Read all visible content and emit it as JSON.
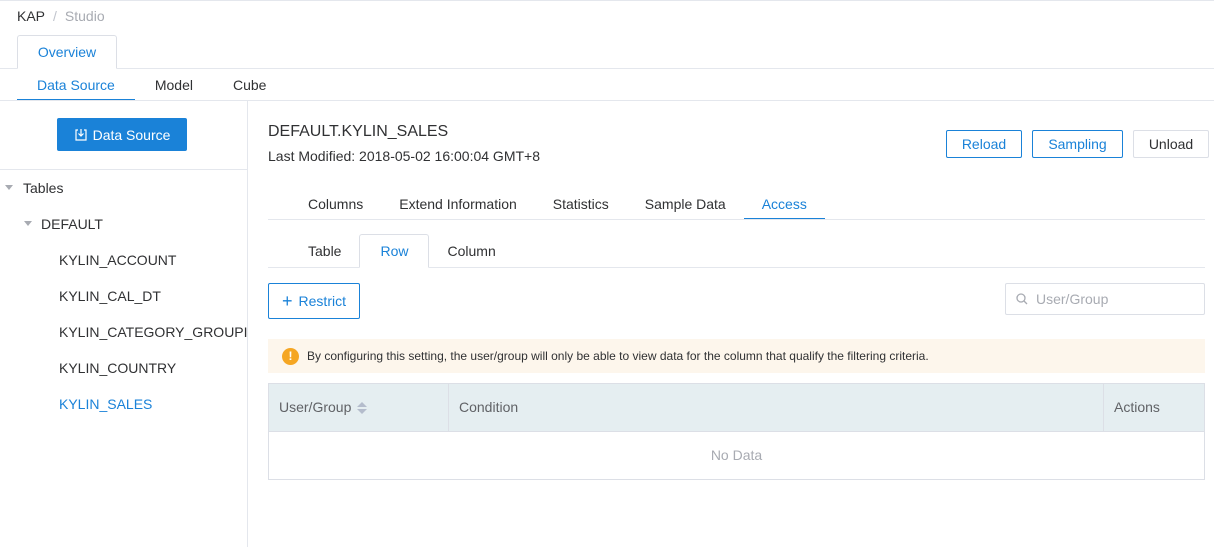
{
  "breadcrumb": {
    "first": "KAP",
    "separator": "/",
    "second": "Studio"
  },
  "card_tab": {
    "label": "Overview"
  },
  "main_nav": {
    "tabs": [
      "Data Source",
      "Model",
      "Cube"
    ],
    "active": "Data Source"
  },
  "sidebar": {
    "data_source_button": "Data Source",
    "tree": {
      "root": "Tables",
      "database": "DEFAULT",
      "tables": [
        "KYLIN_ACCOUNT",
        "KYLIN_CAL_DT",
        "KYLIN_CATEGORY_GROUPINGS",
        "KYLIN_COUNTRY",
        "KYLIN_SALES"
      ],
      "selected": "KYLIN_SALES"
    }
  },
  "detail": {
    "title": "DEFAULT.KYLIN_SALES",
    "last_modified": "Last Modified: 2018-05-02 16:00:04 GMT+8",
    "buttons": {
      "reload": "Reload",
      "sampling": "Sampling",
      "unload": "Unload"
    },
    "tabs": [
      "Columns",
      "Extend Information",
      "Statistics",
      "Sample Data",
      "Access"
    ],
    "active_tab": "Access"
  },
  "access": {
    "sub_tabs": [
      "Table",
      "Row",
      "Column"
    ],
    "active_sub_tab": "Row",
    "restrict_button": "Restrict",
    "search_placeholder": "User/Group",
    "alert_text": "By configuring this setting, the user/group will only be able to view data for the column that qualify the filtering criteria.",
    "table": {
      "columns": [
        "User/Group",
        "Condition",
        "Actions"
      ],
      "empty_text": "No Data"
    }
  },
  "colors": {
    "accent": "#1a82d8",
    "warning": "#f5a623",
    "table_header_bg": "#e5eef1",
    "alert_bg": "#fdf6ec"
  },
  "icons": {
    "data_source": "import-icon",
    "search": "search-icon",
    "warning": "warning-icon",
    "sort": "sort-icon",
    "caret": "caret-down-icon",
    "plus": "plus-icon"
  }
}
